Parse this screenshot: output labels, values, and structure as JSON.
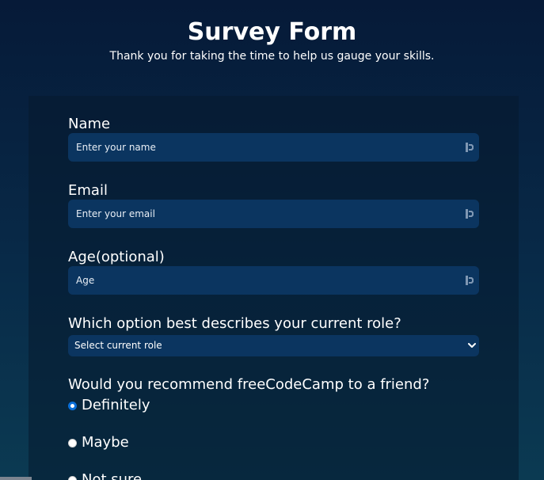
{
  "header": {
    "title": "Survey Form",
    "description": "Thank you for taking the time to help us gauge your skills."
  },
  "form": {
    "name": {
      "label": "Name",
      "placeholder": "Enter your name",
      "value": ""
    },
    "email": {
      "label": "Email",
      "placeholder": "Enter your email",
      "value": ""
    },
    "age": {
      "label": "Age(optional)",
      "placeholder": "Age",
      "value": ""
    },
    "role": {
      "label": "Which option best describes your current role?",
      "selected": "Select current role"
    },
    "recommend": {
      "label": "Would you recommend freeCodeCamp to a friend?",
      "options": [
        {
          "label": "Definitely",
          "checked": true
        },
        {
          "label": "Maybe",
          "checked": false
        },
        {
          "label": "Not sure",
          "checked": false
        }
      ]
    }
  },
  "icons": {
    "autofill": "password-manager-icon",
    "dropdown": "chevron-down-icon"
  },
  "colors": {
    "background_top": "#061a38",
    "background_bottom": "#0b3a52",
    "input_background": "#0b3560",
    "radio_accent": "#0a6fd8"
  }
}
